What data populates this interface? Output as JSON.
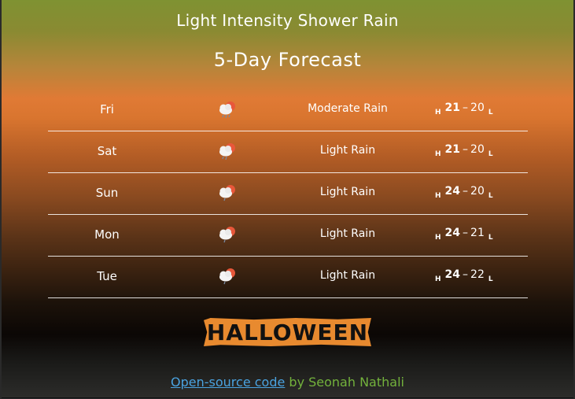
{
  "header": {
    "title": "Light Intensity Shower Rain",
    "subtitle": "5-Day Forecast"
  },
  "forecast": [
    {
      "day": "Fri",
      "icon": "cloud-sun-rain-icon",
      "description": "Moderate Rain",
      "high": "21",
      "low": "20"
    },
    {
      "day": "Sat",
      "icon": "cloud-sun-rain-icon",
      "description": "Light Rain",
      "high": "21",
      "low": "20"
    },
    {
      "day": "Sun",
      "icon": "cloud-sun-rain-icon",
      "description": "Light Rain",
      "high": "24",
      "low": "20"
    },
    {
      "day": "Mon",
      "icon": "cloud-sun-rain-icon",
      "description": "Light Rain",
      "high": "24",
      "low": "21"
    },
    {
      "day": "Tue",
      "icon": "cloud-sun-rain-icon",
      "description": "Light Rain",
      "high": "24",
      "low": "22"
    }
  ],
  "labels": {
    "high": "H",
    "low": "L",
    "dash": "–"
  },
  "logo": {
    "text": "HALLOWEEN"
  },
  "footer": {
    "link_text": "Open-source code",
    "by_text": " by Seonah Nathali"
  },
  "colors": {
    "link": "#4aa3e0",
    "author": "#73b23c",
    "logo_bg": "#e88a2f"
  }
}
